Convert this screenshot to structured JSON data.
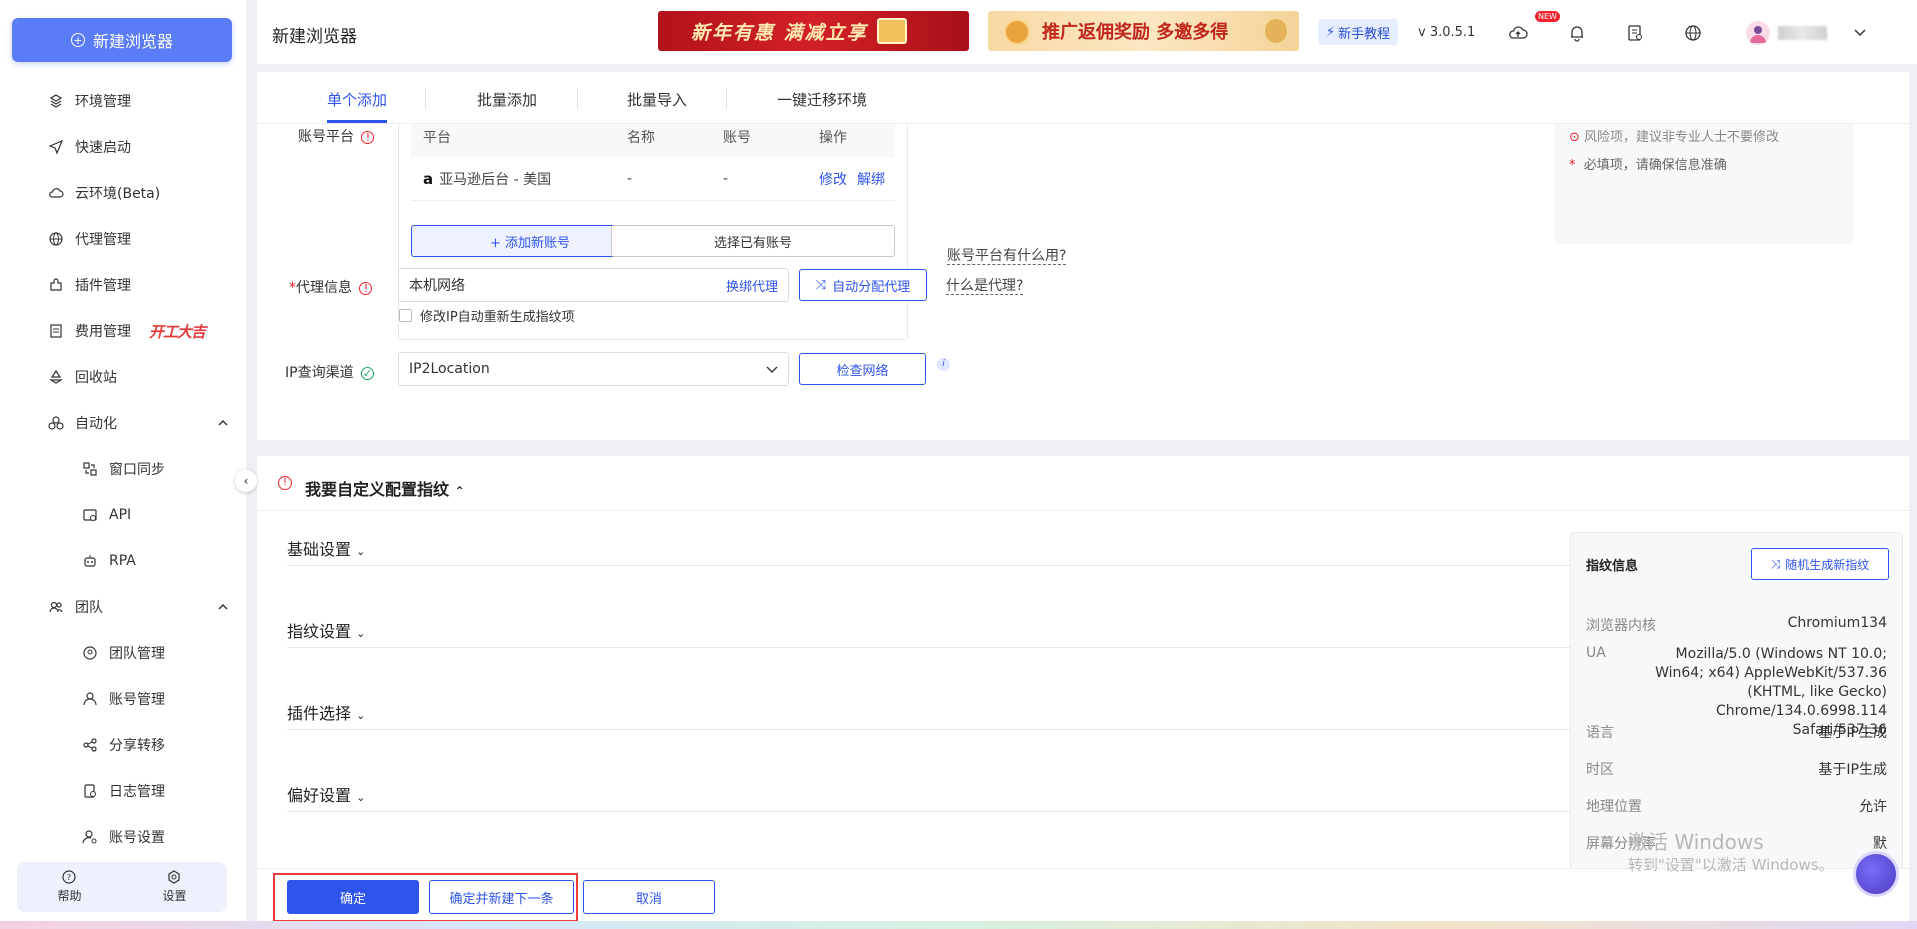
{
  "sidebar": {
    "new_browser": "新建浏览器",
    "items": [
      {
        "label": "环境管理",
        "icon": "environment-icon"
      },
      {
        "label": "快速启动",
        "icon": "send-icon"
      },
      {
        "label": "云环境(Beta)",
        "icon": "cloud-icon"
      },
      {
        "label": "代理管理",
        "icon": "globe-icon"
      },
      {
        "label": "插件管理",
        "icon": "plugin-icon"
      },
      {
        "label": "费用管理",
        "icon": "billing-icon"
      },
      {
        "label": "回收站",
        "icon": "recycle-icon"
      },
      {
        "label": "自动化",
        "icon": "automation-icon"
      },
      {
        "label": "窗口同步",
        "icon": "window-sync-icon"
      },
      {
        "label": "API",
        "icon": "api-icon"
      },
      {
        "label": "RPA",
        "icon": "robot-icon"
      },
      {
        "label": "团队",
        "icon": "team-icon"
      },
      {
        "label": "团队管理",
        "icon": "user-circle-icon"
      },
      {
        "label": "账号管理",
        "icon": "user-icon"
      },
      {
        "label": "分享转移",
        "icon": "share-icon"
      },
      {
        "label": "日志管理",
        "icon": "log-icon"
      },
      {
        "label": "账号设置",
        "icon": "user-settings-icon"
      }
    ],
    "promo_badge": "开工大吉",
    "help": "帮助",
    "settings": "设置"
  },
  "header": {
    "title": "新建浏览器",
    "banner1": "新年有惠 满减立享",
    "banner2": "推广返佣奖励 多邀多得",
    "tutorial": "新手教程",
    "version": "v 3.0.5.1",
    "new_tag": "NEW"
  },
  "tabs": [
    "单个添加",
    "批量添加",
    "批量导入",
    "一键迁移环境"
  ],
  "account_platform": {
    "label": "账号平台",
    "columns": [
      "平台",
      "名称",
      "账号",
      "操作"
    ],
    "rows": [
      {
        "platform": "亚马逊后台 - 美国",
        "name": "-",
        "account": "-",
        "edit": "修改",
        "unbind": "解绑"
      }
    ],
    "add_new": "+ 添加新账号",
    "select_existing": "选择已有账号",
    "help_link": "账号平台有什么用?"
  },
  "proxy": {
    "label": "代理信息",
    "value": "本机网络",
    "change": "换绑代理",
    "auto_assign": "自动分配代理",
    "help_link": "什么是代理?",
    "checkbox_label": "修改IP自动重新生成指纹项"
  },
  "ip_query": {
    "label": "IP查询渠道",
    "value": "IP2Location",
    "check_btn": "检查网络"
  },
  "right_notes": [
    "风险项，建议非专业人士不要修改",
    "必填项，请确保信息准确"
  ],
  "custom_section": {
    "title": "我要自定义配置指纹",
    "subsections": [
      "基础设置",
      "指纹设置",
      "插件选择",
      "偏好设置"
    ]
  },
  "fingerprint": {
    "title": "指纹信息",
    "random_btn": "随机生成新指纹",
    "rows": [
      {
        "k": "浏览器内核",
        "v": "Chromium134"
      },
      {
        "k": "UA",
        "v": "Mozilla/5.0 (Windows NT 10.0; Win64; x64) AppleWebKit/537.36 (KHTML, like Gecko) Chrome/134.0.6998.114 Safari/537.36"
      },
      {
        "k": "语言",
        "v": "基于IP生成"
      },
      {
        "k": "时区",
        "v": "基于IP生成"
      },
      {
        "k": "地理位置",
        "v": "允许"
      },
      {
        "k": "屏幕分辨率",
        "v": "默"
      }
    ]
  },
  "footer": {
    "confirm": "确定",
    "confirm_next": "确定并新建下一条",
    "cancel": "取消"
  },
  "watermark": {
    "line1": "激活 Windows",
    "line2": "转到\"设置\"以激活 Windows。"
  },
  "colors": {
    "primary": "#2f54eb",
    "sidebar_btn": "#5b7cf7",
    "required": "#f5222d",
    "highlight_box": "#ef3b3b"
  }
}
